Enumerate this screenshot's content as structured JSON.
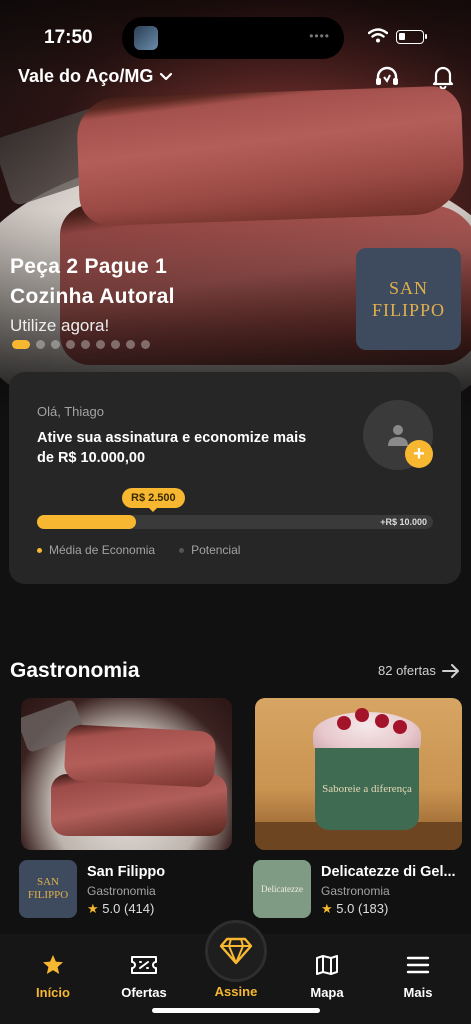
{
  "status_bar": {
    "time": "17:50"
  },
  "header": {
    "location": "Vale do Aço/MG"
  },
  "banner": {
    "line1": "Peça 2 Pague 1",
    "line2": "Cozinha Autoral",
    "line3": "Utilize agora!",
    "logo_line1": "SAN",
    "logo_line2": "FILIPPO",
    "slide_count": 9,
    "active_slide": 1
  },
  "savings_card": {
    "greeting": "Olá, Thiago",
    "message": "Ative sua assinatura e economize mais de  R$ 10.000,00",
    "progress_label": "R$ 2.500",
    "max_label": "+R$ 10.000",
    "progress_value": 2500,
    "progress_max": 10000,
    "legend_average": "Média de Economia",
    "legend_potential": "Potencial"
  },
  "section": {
    "title": "Gastronomia",
    "link": "82 ofertas"
  },
  "offers": [
    {
      "name": "San Filippo",
      "category": "Gastronomia",
      "rating": "5.0",
      "reviews": "(414)",
      "logo_line1": "SAN",
      "logo_line2": "FILIPPO"
    },
    {
      "name": "Delicatezze di Gel...",
      "category": "Gastronomia",
      "rating": "5.0",
      "reviews": "(183)",
      "logo_text": "Delicatezze",
      "cup_text": "Saboreie a diferença"
    }
  ],
  "tabs": [
    {
      "label": "Início",
      "icon": "star-icon",
      "active": true
    },
    {
      "label": "Ofertas",
      "icon": "ticket-icon",
      "active": false
    },
    {
      "label": "Assine",
      "icon": "diamond-icon",
      "active": false
    },
    {
      "label": "Mapa",
      "icon": "map-icon",
      "active": false
    },
    {
      "label": "Mais",
      "icon": "menu-icon",
      "active": false
    }
  ],
  "colors": {
    "accent": "#f7b731",
    "background": "#111111",
    "card": "#262626",
    "logo_bg": "#3e4a5e",
    "logo_text": "#e0b04b"
  }
}
